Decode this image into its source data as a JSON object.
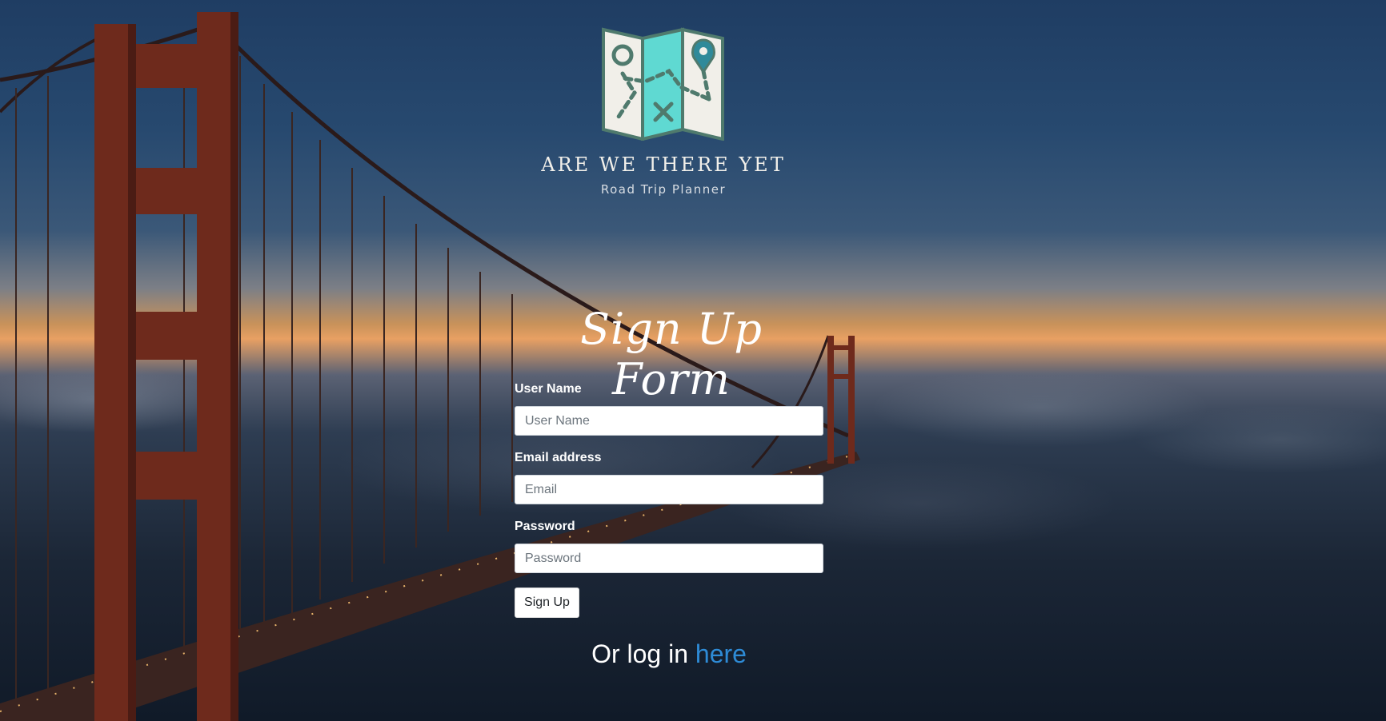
{
  "brand": {
    "title": "ARE WE THERE YET",
    "subtitle": "Road Trip Planner",
    "logo_icon": "folded-map-icon"
  },
  "form": {
    "title": "Sign Up Form",
    "username": {
      "label": "User Name",
      "placeholder": "User Name",
      "value": ""
    },
    "email": {
      "label": "Email address",
      "placeholder": "Email",
      "value": ""
    },
    "password": {
      "label": "Password",
      "placeholder": "Password",
      "value": ""
    },
    "submit_label": "Sign Up"
  },
  "login": {
    "prefix": "Or log in ",
    "link_text": "here"
  },
  "colors": {
    "link": "#2e8bd6",
    "logo_teal": "#5fd9d2",
    "logo_outline": "#4f7a6d",
    "logo_paper": "#f1efe9"
  }
}
